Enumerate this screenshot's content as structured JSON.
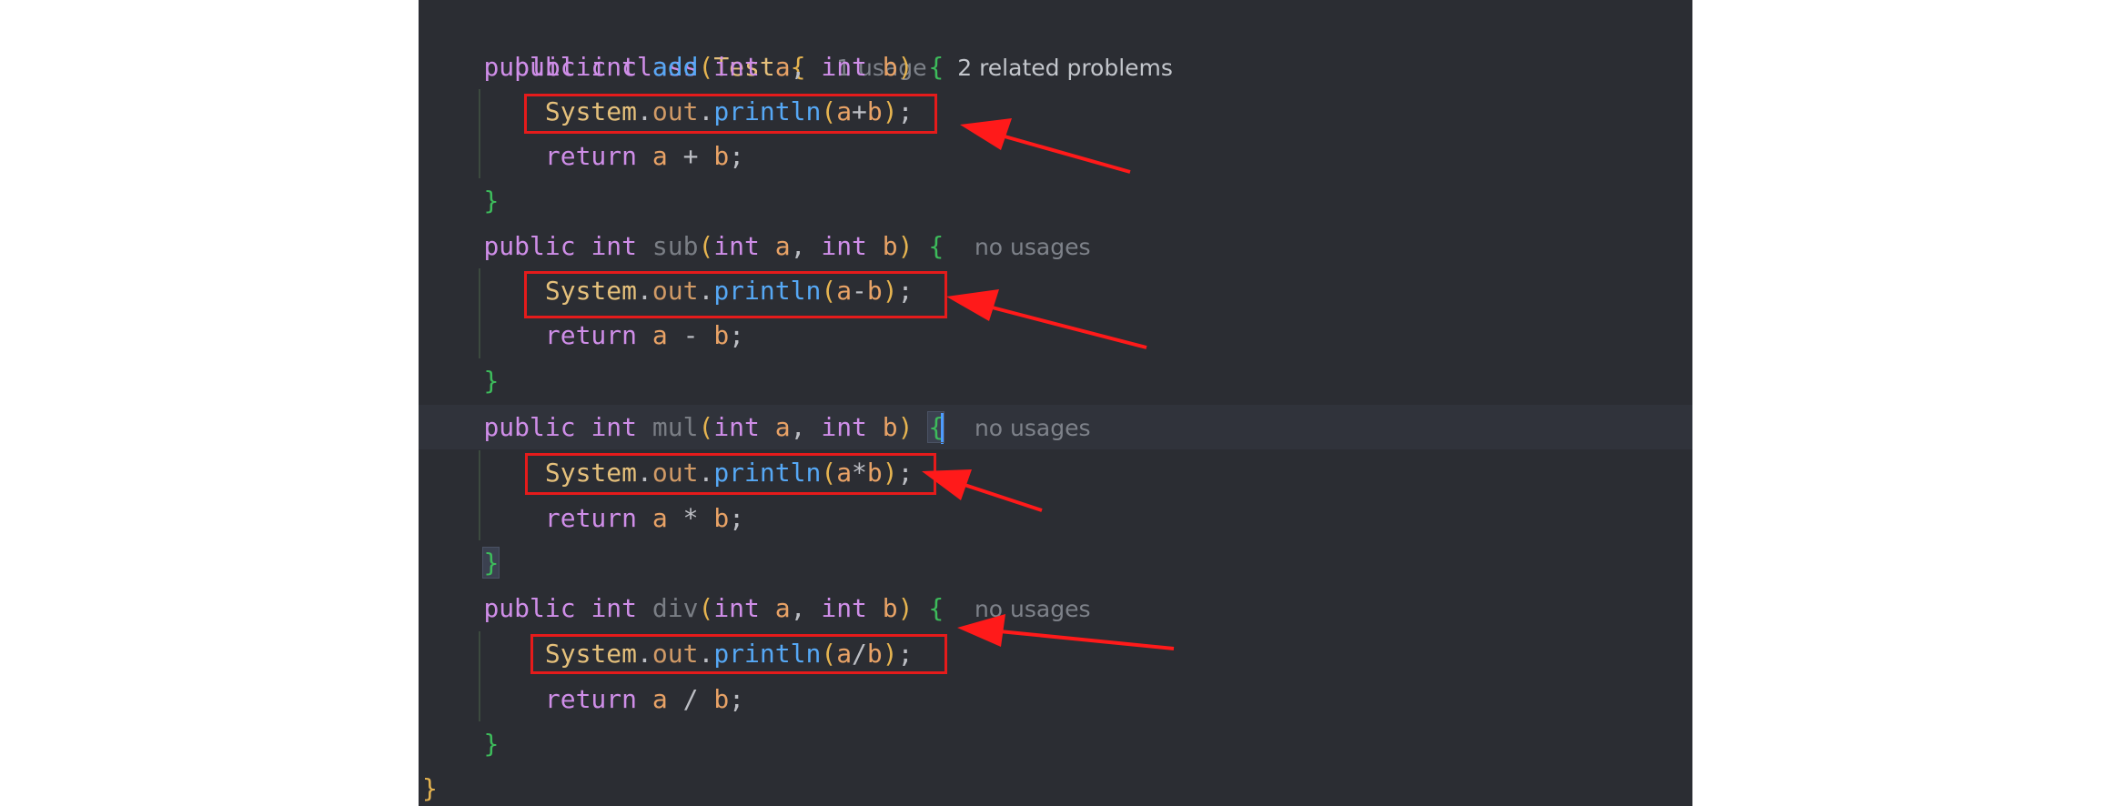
{
  "editor": {
    "class_decl": {
      "kw1": "public",
      "kw2": "class",
      "name": "Test",
      "brace": "{"
    },
    "class_hints": {
      "usage": "1 usage",
      "problems": "2 related problems"
    },
    "methods": [
      {
        "sig": {
          "kw1": "public",
          "type": "int",
          "name": "add",
          "open": "(",
          "p1t": "int",
          "p1": "a",
          "comma": ",",
          "p2t": "int",
          "p2": "b",
          "close": ")",
          "brace": "{"
        },
        "hint": "",
        "print": {
          "cls": "System",
          "dot1": ".",
          "field": "out",
          "dot2": ".",
          "fn": "println",
          "open": "(",
          "a": "a",
          "op": "+",
          "b": "b",
          "close": ")",
          "semi": ";"
        },
        "ret": {
          "kw": "return",
          "a": "a",
          "op": "+",
          "b": "b",
          "semi": ";"
        },
        "end": "}"
      },
      {
        "sig": {
          "kw1": "public",
          "type": "int",
          "name": "sub",
          "open": "(",
          "p1t": "int",
          "p1": "a",
          "comma": ",",
          "p2t": "int",
          "p2": "b",
          "close": ")",
          "brace": "{"
        },
        "hint": "no usages",
        "print": {
          "cls": "System",
          "dot1": ".",
          "field": "out",
          "dot2": ".",
          "fn": "println",
          "open": "(",
          "a": "a",
          "op": "-",
          "b": "b",
          "close": ")",
          "semi": ";"
        },
        "ret": {
          "kw": "return",
          "a": "a",
          "op": "-",
          "b": "b",
          "semi": ";"
        },
        "end": "}"
      },
      {
        "sig": {
          "kw1": "public",
          "type": "int",
          "name": "mul",
          "open": "(",
          "p1t": "int",
          "p1": "a",
          "comma": ",",
          "p2t": "int",
          "p2": "b",
          "close": ")",
          "brace": "{"
        },
        "hint": "no usages",
        "print": {
          "cls": "System",
          "dot1": ".",
          "field": "out",
          "dot2": ".",
          "fn": "println",
          "open": "(",
          "a": "a",
          "op": "*",
          "b": "b",
          "close": ")",
          "semi": ";"
        },
        "ret": {
          "kw": "return",
          "a": "a",
          "op": "*",
          "b": "b",
          "semi": ";"
        },
        "end": "}"
      },
      {
        "sig": {
          "kw1": "public",
          "type": "int",
          "name": "div",
          "open": "(",
          "p1t": "int",
          "p1": "a",
          "comma": ",",
          "p2t": "int",
          "p2": "b",
          "close": ")",
          "brace": "{"
        },
        "hint": "no usages",
        "print": {
          "cls": "System",
          "dot1": ".",
          "field": "out",
          "dot2": ".",
          "fn": "println",
          "open": "(",
          "a": "a",
          "op": "/",
          "b": "b",
          "close": ")",
          "semi": ";"
        },
        "ret": {
          "kw": "return",
          "a": "a",
          "op": "/",
          "b": "b",
          "semi": ";"
        },
        "end": "}"
      }
    ],
    "class_end": "}"
  },
  "colors": {
    "editor_bg": "#2b2d33",
    "keyword": "#cf8ee8",
    "class_name": "#e5c07b",
    "method": "#56a8f5",
    "annotation_box": "#e51b1b",
    "annotation_arrow": "#ff1a1a"
  }
}
